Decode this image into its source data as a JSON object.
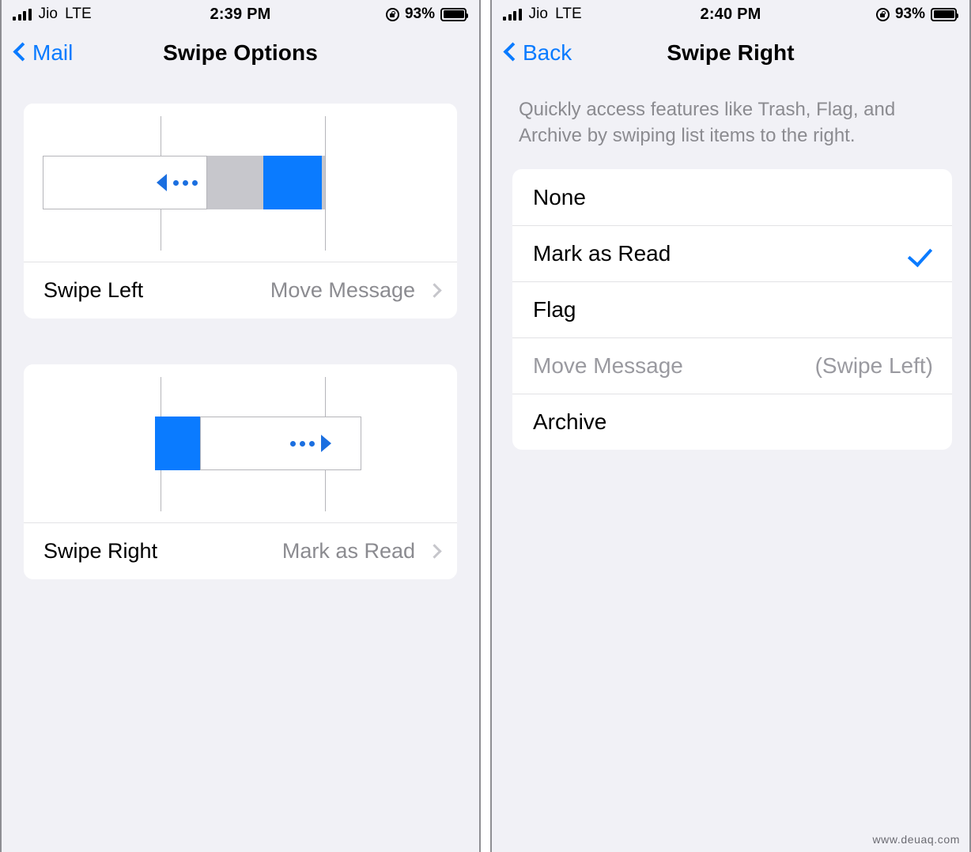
{
  "left_screen": {
    "status_bar": {
      "carrier": "Jio",
      "network": "LTE",
      "time": "2:39 PM",
      "battery_percent": "93%",
      "signal_icon": "signal-bars-icon",
      "rotation_lock_icon": "rotation-lock-icon",
      "battery_icon": "battery-full-icon"
    },
    "nav": {
      "back_label": "Mail",
      "title": "Swipe Options",
      "back_icon": "chevron-left-icon"
    },
    "cards": [
      {
        "illustration": "swipe-left-illustration",
        "direction": "left",
        "label": "Swipe Left",
        "value": "Move Message",
        "chevron_icon": "chevron-right-icon"
      },
      {
        "illustration": "swipe-right-illustration",
        "direction": "right",
        "label": "Swipe Right",
        "value": "Mark as Read",
        "chevron_icon": "chevron-right-icon"
      }
    ]
  },
  "right_screen": {
    "status_bar": {
      "carrier": "Jio",
      "network": "LTE",
      "time": "2:40 PM",
      "battery_percent": "93%",
      "signal_icon": "signal-bars-icon",
      "rotation_lock_icon": "rotation-lock-icon",
      "battery_icon": "battery-full-icon"
    },
    "nav": {
      "back_label": "Back",
      "title": "Swipe Right",
      "back_icon": "chevron-left-icon"
    },
    "description": "Quickly access features like Trash, Flag, and Archive by swiping list items to the right.",
    "options": [
      {
        "label": "None",
        "right_text": "",
        "selected": false,
        "disabled": false
      },
      {
        "label": "Mark as Read",
        "right_text": "",
        "selected": true,
        "disabled": false
      },
      {
        "label": "Flag",
        "right_text": "",
        "selected": false,
        "disabled": false
      },
      {
        "label": "Move Message",
        "right_text": "(Swipe Left)",
        "selected": false,
        "disabled": true
      },
      {
        "label": "Archive",
        "right_text": "",
        "selected": false,
        "disabled": false
      }
    ],
    "check_icon": "checkmark-icon"
  },
  "watermark": "www.deuaq.com",
  "colors": {
    "accent_blue": "#0A7BFF",
    "illustration_blue": "#0A7BFF",
    "illustration_gray": "#C7C7CC",
    "page_background": "#F1F1F6",
    "card_background": "#FFFFFF",
    "secondary_text": "#8B8B90"
  }
}
